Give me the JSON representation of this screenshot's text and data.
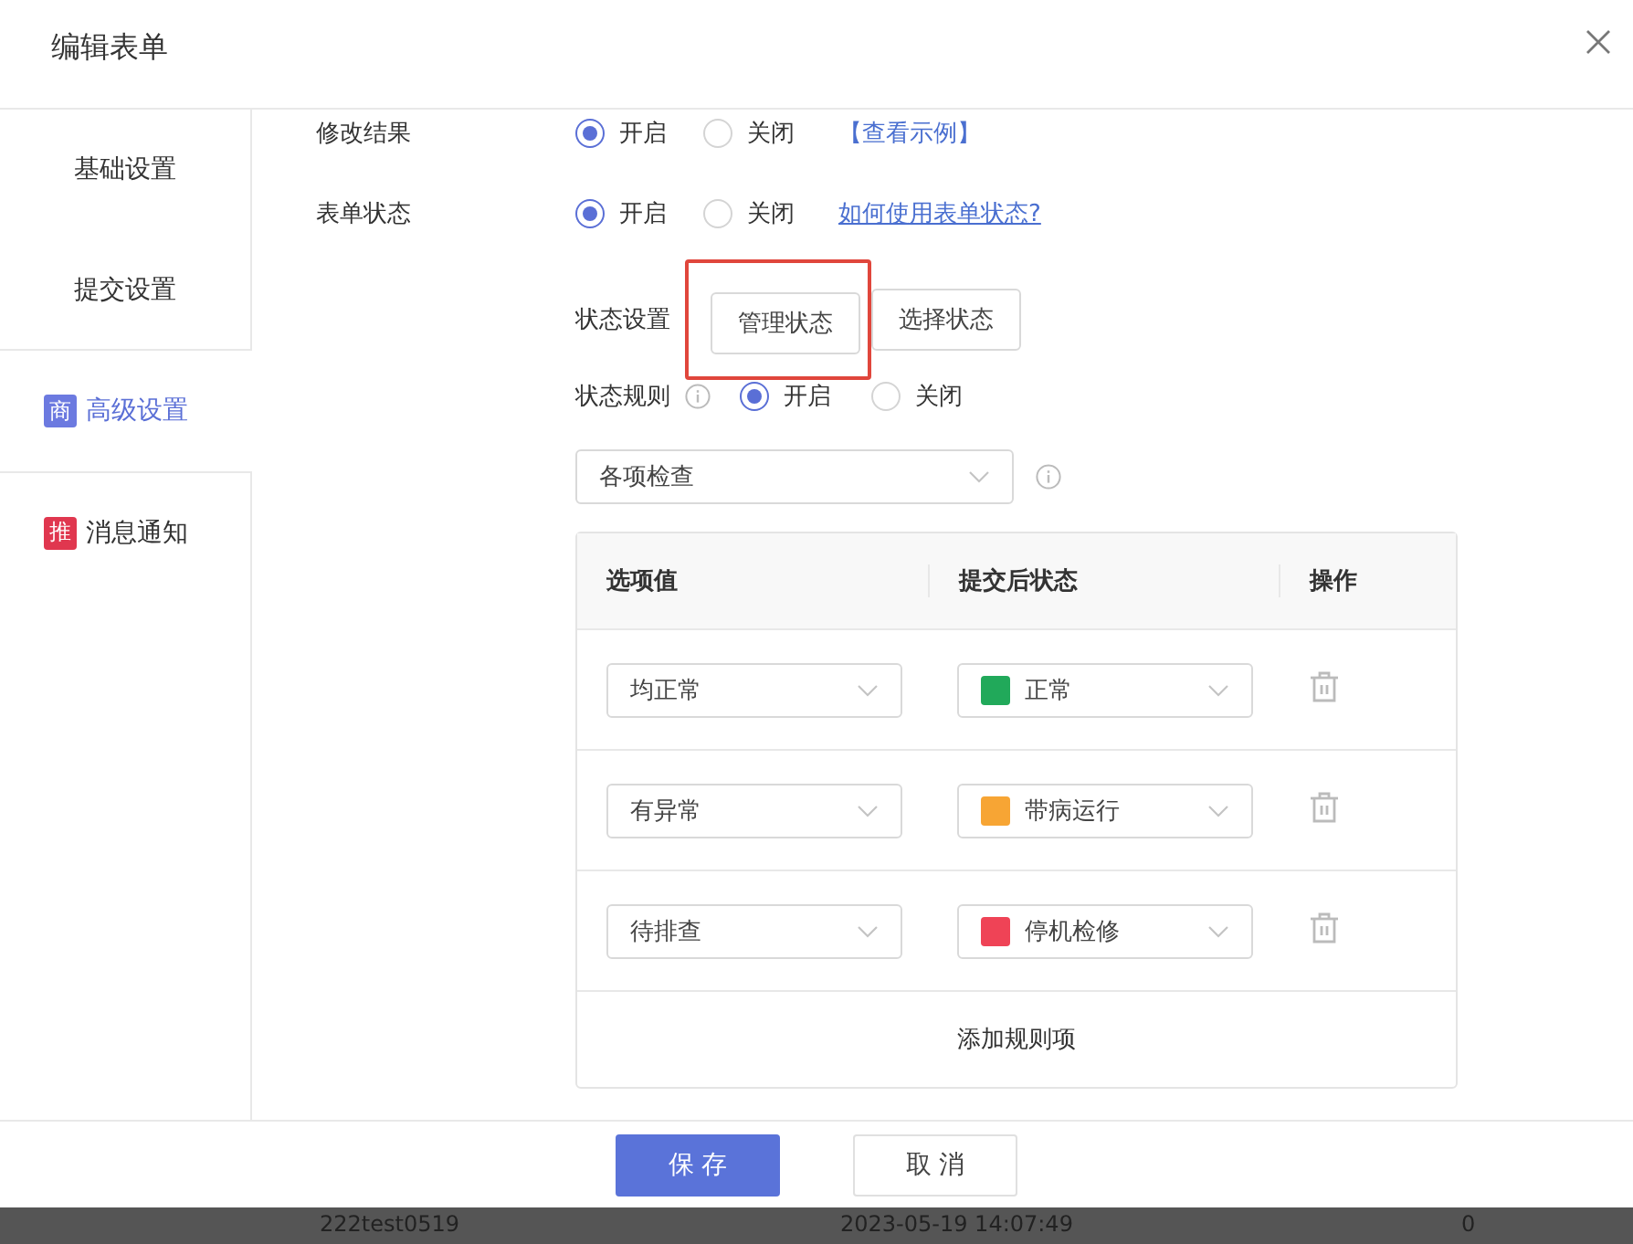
{
  "dialog": {
    "title": "编辑表单"
  },
  "sidebar": {
    "items": [
      {
        "label": "基础设置",
        "selected": false
      },
      {
        "label": "提交设置",
        "selected": false
      },
      {
        "label": "高级设置",
        "badge": "商",
        "color": "#6c7ae0",
        "selected": true
      },
      {
        "label": "消息通知",
        "badge": "推",
        "color": "#e0374f",
        "selected": false
      }
    ]
  },
  "settings": [
    {
      "label": "修改结果",
      "options": [
        {
          "label": "开启",
          "selected": true
        },
        {
          "label": "关闭",
          "selected": false
        }
      ],
      "link": "【查看示例】",
      "kind": "plain"
    },
    {
      "label": "表单状态",
      "options": [
        {
          "label": "开启",
          "selected": true
        },
        {
          "label": "关闭",
          "selected": false
        }
      ],
      "link": "如何使用表单状态?",
      "kind": "underline"
    }
  ],
  "status_settings": {
    "label": "状态设置",
    "buttons": [
      {
        "label": "管理状态",
        "highlighted": true
      },
      {
        "label": "选择状态",
        "highlighted": false
      }
    ]
  },
  "status_rule": {
    "label": "状态规则",
    "options": [
      {
        "label": "开启",
        "selected": true
      },
      {
        "label": "关闭",
        "selected": false
      }
    ]
  },
  "check_select": {
    "value": "各项检查"
  },
  "table": {
    "columns": [
      "选项值",
      "提交后状态",
      "操作"
    ],
    "rows": [
      {
        "option": "均正常",
        "status": "正常",
        "color": "#21a95a"
      },
      {
        "option": "有异常",
        "status": "带病运行",
        "color": "#f7a534"
      },
      {
        "option": "待排查",
        "status": "停机检修",
        "color": "#ef4356"
      }
    ],
    "add_label": "添加规则项"
  },
  "footer": {
    "buttons": [
      {
        "label": "保 存",
        "kind": "primary"
      },
      {
        "label": "取 消",
        "kind": "default"
      }
    ]
  },
  "backdrop_row": [
    "222test0519",
    "2023-05-19 14:07:49",
    "0"
  ]
}
